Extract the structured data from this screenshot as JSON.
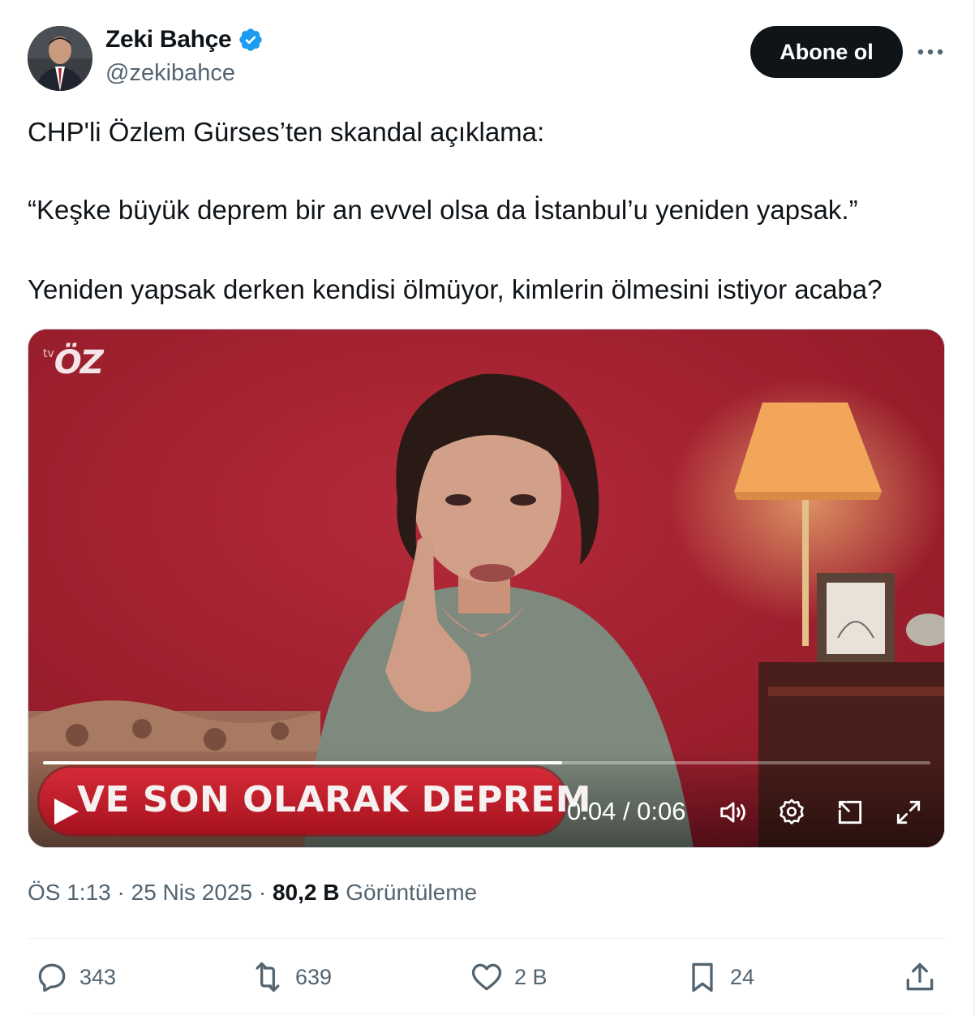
{
  "author": {
    "name": "Zeki Bahçe",
    "handle": "@zekibahce",
    "verified": true
  },
  "header": {
    "follow_label": "Abone ol",
    "more_icon": "more-horizontal-icon"
  },
  "tweet": {
    "lines": [
      "CHP'li Özlem Gürses’ten skandal açıklama:",
      "“Keşke büyük deprem bir an evvel olsa da İstanbul’u yeniden yapsak.”",
      "Yeniden yapsak derken kendisi ölmüyor, kimlerin ölmesini istiyor acaba?"
    ]
  },
  "video": {
    "channel_logo_prefix": "tv",
    "channel_logo": "ÖZ",
    "lower_third": "VE SON OLARAK DEPREM",
    "time": "0:04 / 0:06",
    "progress": 0.585,
    "controls": [
      "play-icon",
      "volume-icon",
      "settings-icon",
      "pip-icon",
      "fullscreen-icon"
    ]
  },
  "meta": {
    "time": "ÖS 1:13",
    "date": "25 Nis 2025",
    "sep": "·",
    "views_count": "80,2 B",
    "views_label": "Görüntüleme"
  },
  "actions": {
    "replies": "343",
    "reposts": "639",
    "likes": "2 B",
    "bookmarks": "24"
  },
  "colors": {
    "text": "#0f1419",
    "secondary": "#536471",
    "verified": "#1d9bf0",
    "lower_third": "#c41e2c",
    "backdrop": "#a11f2e"
  }
}
